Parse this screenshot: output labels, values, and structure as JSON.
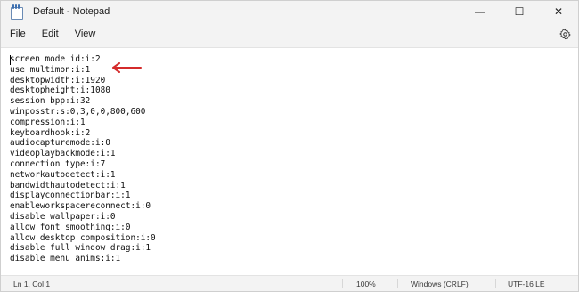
{
  "window": {
    "title": "Default - Notepad",
    "controls": {
      "minimize": "—",
      "maximize": "☐",
      "close": "✕"
    }
  },
  "menu": {
    "items": [
      "File",
      "Edit",
      "View"
    ],
    "settings_icon": "gear-icon"
  },
  "editor": {
    "lines": [
      "screen mode id:i:2",
      "use multimon:i:1",
      "desktopwidth:i:1920",
      "desktopheight:i:1080",
      "session bpp:i:32",
      "winposstr:s:0,3,0,0,800,600",
      "compression:i:1",
      "keyboardhook:i:2",
      "audiocapturemode:i:0",
      "videoplaybackmode:i:1",
      "connection type:i:7",
      "networkautodetect:i:1",
      "bandwidthautodetect:i:1",
      "displayconnectionbar:i:1",
      "enableworkspacereconnect:i:0",
      "disable wallpaper:i:0",
      "allow font smoothing:i:0",
      "allow desktop composition:i:0",
      "disable full window drag:i:1",
      "disable menu anims:i:1"
    ],
    "annotation": {
      "icon": "red-arrow-icon",
      "color": "#d42b2b"
    }
  },
  "status": {
    "position": "Ln 1, Col 1",
    "zoom": "100%",
    "line_ending": "Windows (CRLF)",
    "encoding": "UTF-16 LE"
  }
}
